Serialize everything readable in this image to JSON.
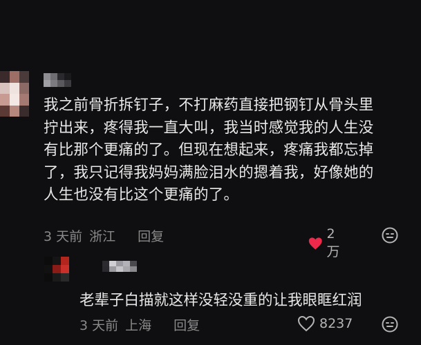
{
  "main_comment": {
    "text_lines": [
      "我之前骨折拆钉子，不打麻药直接把钢钉从骨头里",
      "拧出来，疼得我一直大叫，我当时感觉我的人生没",
      "有比那个更痛的了。但现在想起来，疼痛我都忘掉",
      "了，我只记得我妈妈满脸泪水的摁着我，好像她的",
      "人生也没有比这个更痛的了。"
    ],
    "time": "3 天前",
    "location": "浙江",
    "reply_label": "回复",
    "like_count": "2万",
    "liked": true,
    "like_icon": "heart-filled-icon",
    "emoji_icon": "emoji-face-icon"
  },
  "sub_comment": {
    "text": "老辈子白描就这样没轻没重的让我眼眶红润",
    "time": "3 天前",
    "location": "上海",
    "reply_label": "回复",
    "like_count": "8237",
    "liked": false,
    "like_icon": "heart-outline-icon",
    "emoji_icon": "emoji-face-icon"
  },
  "colors": {
    "background": "#0f0f11",
    "text": "#e8e8e8",
    "meta": "#8a8a8a",
    "like_active": "#f0284a",
    "like_inactive": "#b5b5b5"
  }
}
